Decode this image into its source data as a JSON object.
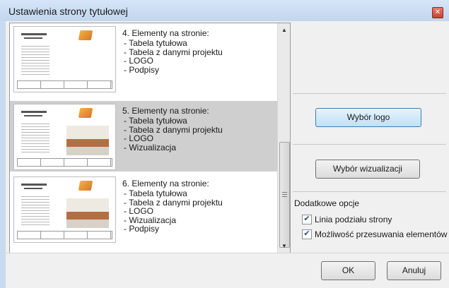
{
  "window": {
    "title": "Ustawienia strony tytułowej"
  },
  "icons": {
    "close": "close-icon",
    "scroll_up": "arrow-up-icon",
    "scroll_down": "arrow-down-icon"
  },
  "items": [
    {
      "title": "4. Elementy na stronie:",
      "bullets": [
        "- Tabela tytułowa",
        "- Tabela z danymi projektu",
        "- LOGO",
        "- Podpisy"
      ],
      "has_photo": false,
      "selected": false
    },
    {
      "title": "5. Elementy na stronie:",
      "bullets": [
        "- Tabela tytułowa",
        "- Tabela z danymi projektu",
        "- LOGO",
        "- Wizualizacja"
      ],
      "has_photo": true,
      "selected": true
    },
    {
      "title": "6. Elementy na stronie:",
      "bullets": [
        "- Tabela tytułowa",
        "- Tabela z danymi projektu",
        "- LOGO",
        "- Wizualizacja",
        "- Podpisy"
      ],
      "has_photo": true,
      "selected": false
    }
  ],
  "buttons": {
    "logo": "Wybór logo",
    "visualization": "Wybór wizualizacji",
    "ok": "OK",
    "cancel": "Anuluj"
  },
  "options": {
    "label": "Dodatkowe opcje",
    "checks": [
      {
        "label": "Linia podziału strony",
        "checked": true
      },
      {
        "label": "Możliwość przesuwania elementów",
        "checked": true
      }
    ]
  },
  "colors": {
    "selected_item": "#cfcfcf",
    "focus_button": "#bfe1f8"
  }
}
